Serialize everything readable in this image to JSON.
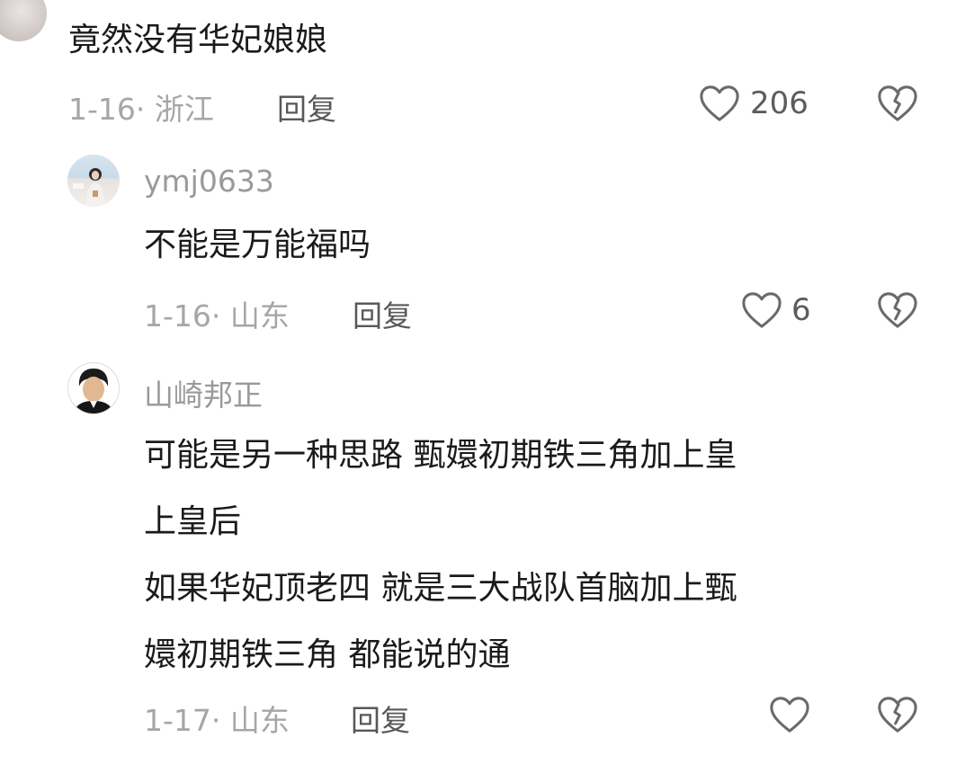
{
  "comments": [
    {
      "text": "竟然没有华妃娘娘",
      "date_location": "1-16· 浙江",
      "reply_label": "回复",
      "like_count": "206"
    },
    {
      "username": "ymj0633",
      "text": "不能是万能福吗",
      "date_location": "1-16· 山东",
      "reply_label": "回复",
      "like_count": "6"
    },
    {
      "username": "山崎邦正",
      "lines": [
        "可能是另一种思路 甄嬛初期铁三角加上皇",
        "上皇后",
        "如果华妃顶老四 就是三大战队首脑加上甄",
        "嬛初期铁三角 都能说的通"
      ],
      "date_location": "1-17· 山东",
      "reply_label": "回复",
      "like_count": ""
    }
  ],
  "icons": {
    "like": "heart-outline-icon",
    "dislike": "broken-heart-icon"
  },
  "colors": {
    "icon_stroke": "#6a6a6a",
    "meta_text": "#a6a6a6",
    "body_text": "#1a1a1a"
  }
}
